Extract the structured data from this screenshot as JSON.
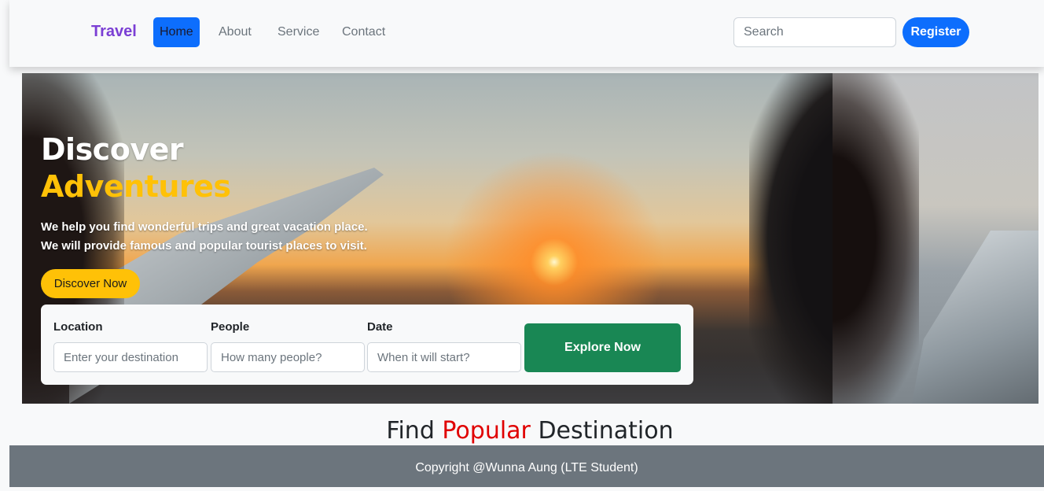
{
  "navbar": {
    "brand": "Travel",
    "links": [
      "Home",
      "About",
      "Service",
      "Contact"
    ],
    "active_link": "Home",
    "search_placeholder": "Search",
    "register_label": "Register"
  },
  "hero": {
    "title_line1": "Discover",
    "title_line2": "Adventures",
    "text_line1": "We help you find wonderful trips and great vacation place.",
    "text_line2": "We will provide famous and popular tourist places to visit.",
    "cta_label": "Discover Now"
  },
  "booking": {
    "location_label": "Location",
    "location_placeholder": "Enter your destination",
    "people_label": "People",
    "people_placeholder": "How many people?",
    "date_label": "Date",
    "date_placeholder": "When it will start?",
    "explore_label": "Explore Now"
  },
  "section": {
    "title_pre": "Find ",
    "title_highlight": "Popular",
    "title_post": " Destination"
  },
  "footer": {
    "copyright": "Copyright @Wunna Aung (LTE Student)"
  },
  "colors": {
    "brand": "#7b3fd4",
    "primary": "#0d6efd",
    "accent": "#ffc107",
    "success": "#198754",
    "highlight": "#e00000",
    "footer_bg": "#6c757d"
  }
}
